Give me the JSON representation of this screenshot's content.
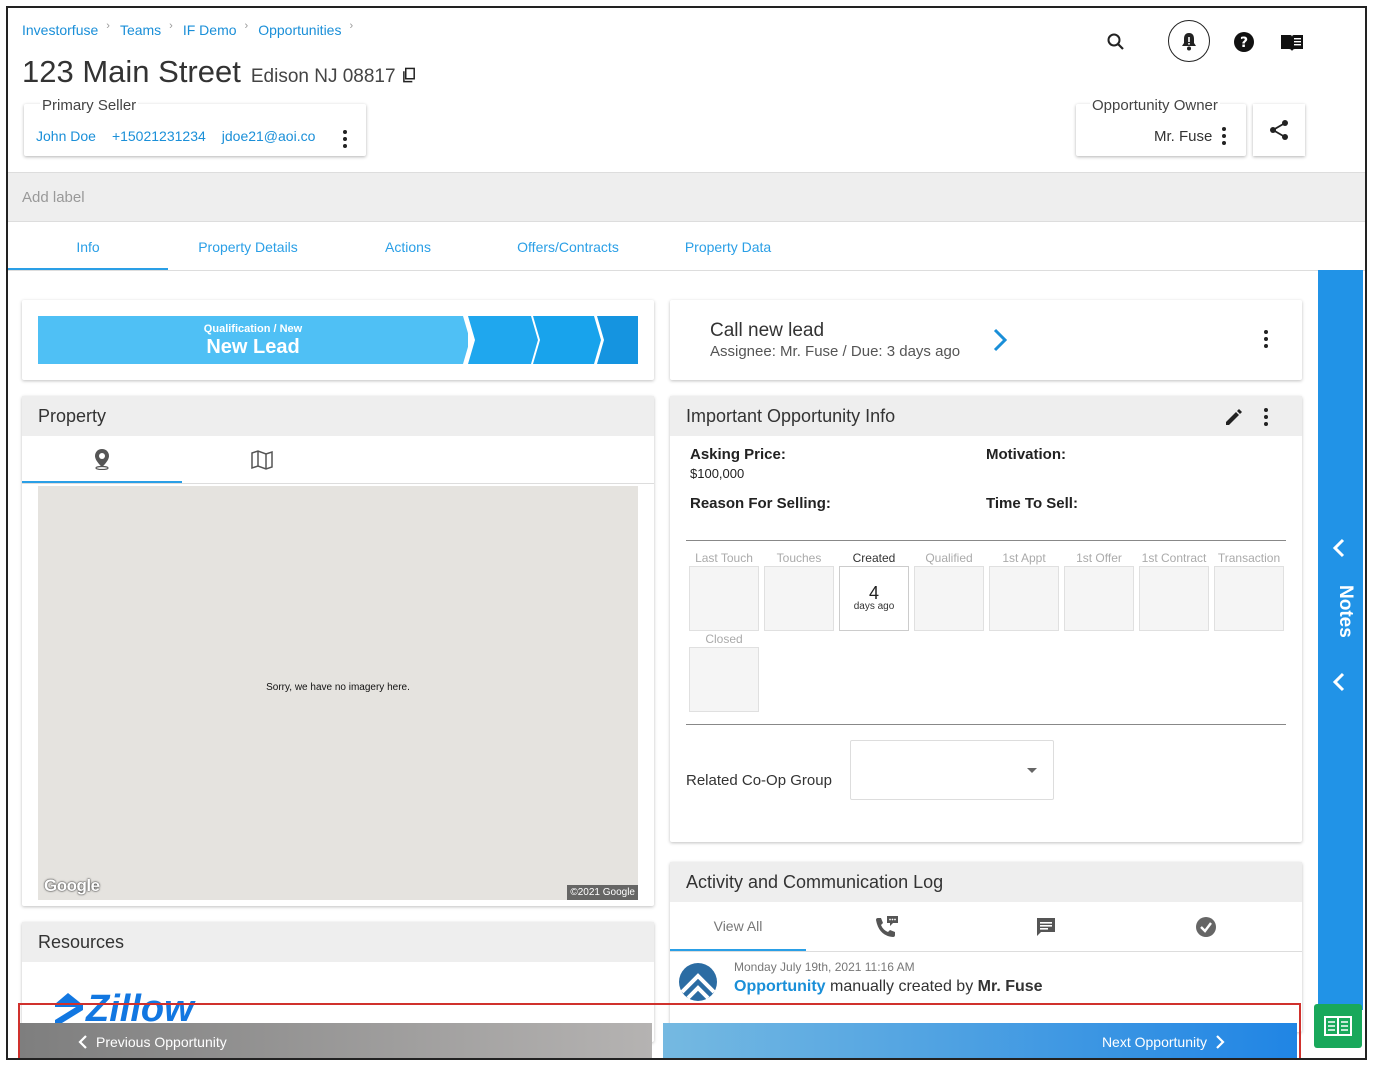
{
  "breadcrumb": [
    "Investorfuse",
    "Teams",
    "IF Demo",
    "Opportunities"
  ],
  "title": {
    "street": "123 Main Street",
    "city": "Edison NJ 08817"
  },
  "seller": {
    "label": "Primary Seller",
    "name": "John Doe",
    "phone": "+15021231234",
    "email": "jdoe21@aoi.co"
  },
  "owner": {
    "label": "Opportunity Owner",
    "name": "Mr. Fuse"
  },
  "label_bar": {
    "placeholder": "Add label"
  },
  "tabs": [
    "Info",
    "Property Details",
    "Actions",
    "Offers/Contracts",
    "Property Data"
  ],
  "stage": {
    "group": "Qualification / New",
    "name": "New Lead"
  },
  "task": {
    "title": "Call new lead",
    "subtitle": "Assignee: Mr. Fuse / Due: 3 days ago"
  },
  "property": {
    "title": "Property",
    "map_message": "Sorry, we have no imagery here.",
    "google": "Google",
    "copyright": "©2021 Google"
  },
  "resources": {
    "title": "Resources",
    "zillow": "Zillow"
  },
  "info": {
    "title": "Important Opportunity Info",
    "asking_label": "Asking Price:",
    "asking_value": "$100,000",
    "motivation_label": "Motivation:",
    "reason_label": "Reason For Selling:",
    "time_label": "Time To Sell:",
    "stats": [
      {
        "name": "Last Touch",
        "value": "",
        "unit": ""
      },
      {
        "name": "Touches",
        "value": "",
        "unit": ""
      },
      {
        "name": "Created",
        "value": "4",
        "unit": "days ago"
      },
      {
        "name": "Qualified",
        "value": "",
        "unit": ""
      },
      {
        "name": "1st Appt",
        "value": "",
        "unit": ""
      },
      {
        "name": "1st Offer",
        "value": "",
        "unit": ""
      },
      {
        "name": "1st Contract",
        "value": "",
        "unit": ""
      },
      {
        "name": "Transaction",
        "value": "",
        "unit": ""
      },
      {
        "name": "Closed",
        "value": "",
        "unit": ""
      }
    ],
    "coop_label": "Related Co-Op Group"
  },
  "activity": {
    "title": "Activity and Communication Log",
    "view_all": "View All",
    "entry_date": "Monday July 19th, 2021 11:16 AM",
    "entry_link": "Opportunity",
    "entry_text": "manually created by",
    "entry_user": "Mr. Fuse"
  },
  "notes": {
    "label": "Notes"
  },
  "nav": {
    "prev": "Previous Opportunity",
    "next": "Next Opportunity"
  },
  "colors": {
    "accent": "#2a9fe6",
    "stage": "#4fc0f5",
    "notes": "#2193e7",
    "zillow": "#1277e1",
    "green": "#19a85b",
    "highlight": "#d0312d"
  }
}
